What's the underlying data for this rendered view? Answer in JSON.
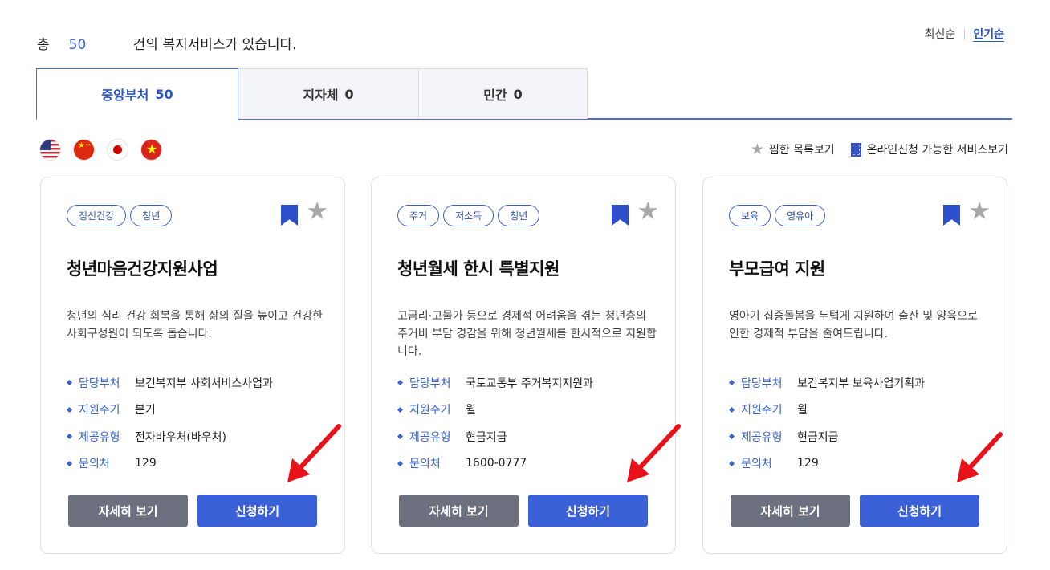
{
  "summary": {
    "prefix": "총",
    "count": "50",
    "suffix": "건의 복지서비스가 있습니다."
  },
  "sort": {
    "latest": "최신순",
    "popular": "인기순",
    "active": "popular"
  },
  "tabs": [
    {
      "label": "중앙부처",
      "count": "50",
      "active": true
    },
    {
      "label": "지자체",
      "count": "0",
      "active": false
    },
    {
      "label": "민간",
      "count": "0",
      "active": false
    }
  ],
  "languages": [
    "us-flag-icon",
    "china-flag-icon",
    "japan-flag-icon",
    "vietnam-flag-icon"
  ],
  "view_links": {
    "favorites": "찜한 목록보기",
    "online": "온라인신청 가능한 서비스보기"
  },
  "info_labels": {
    "department": "담당부처",
    "cycle": "지원주기",
    "type": "제공유형",
    "contact": "문의처"
  },
  "buttons": {
    "detail": "자세히 보기",
    "apply": "신청하기"
  },
  "cards": [
    {
      "tags": [
        "정신건강",
        "청년"
      ],
      "title": "청년마음건강지원사업",
      "description": "청년의 심리 건강 회복을 통해 삶의 질을 높이고 건강한 사회구성원이 되도록 돕습니다.",
      "department": "보건복지부 사회서비스사업과",
      "cycle": "분기",
      "type": "전자바우처(바우처)",
      "contact": "129"
    },
    {
      "tags": [
        "주거",
        "저소득",
        "청년"
      ],
      "title": "청년월세 한시 특별지원",
      "description": "고금리·고물가 등으로 경제적 어려움을 겪는 청년층의 주거비 부담 경감을 위해 청년월세를 한시적으로 지원합니다.",
      "department": "국토교통부 주거복지지원과",
      "cycle": "월",
      "type": "현금지급",
      "contact": "1600-0777"
    },
    {
      "tags": [
        "보육",
        "영유아"
      ],
      "title": "부모급여 지원",
      "description": "영아기 집중돌봄을 두텁게 지원하여 출산 및 양육으로 인한 경제적 부담을 줄여드립니다.",
      "department": "보건복지부 보육사업기획과",
      "cycle": "월",
      "type": "현금지급",
      "contact": "129"
    }
  ],
  "colors": {
    "accent": "#3b61d8",
    "detail_button": "#6d717f",
    "annotation_arrow": "#e8121b"
  }
}
